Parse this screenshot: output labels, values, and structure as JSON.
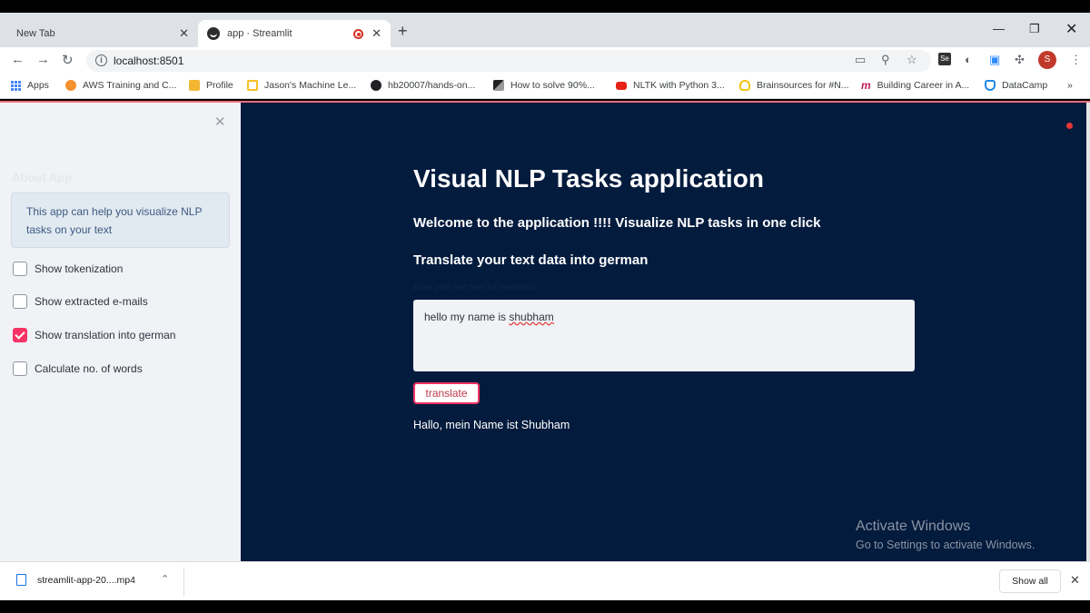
{
  "browser": {
    "tabs": [
      {
        "label": "New Tab"
      },
      {
        "label": "app · Streamlit"
      }
    ],
    "url": "localhost:8501",
    "profile_initial": "S",
    "bookmarks": [
      {
        "label": "Apps",
        "icon": "apps-grid-icon"
      },
      {
        "label": "AWS Training and C...",
        "icon": "aws-icon",
        "color": "#f5912e"
      },
      {
        "label": "Profile",
        "icon": "package-icon",
        "color": "#f2b633"
      },
      {
        "label": "Jason's Machine Le...",
        "icon": "bookmark-yellow-icon",
        "color": "#f6c026"
      },
      {
        "label": "hb20007/hands-on...",
        "icon": "github-icon",
        "color": "#202124"
      },
      {
        "label": "How to solve 90%...",
        "icon": "medium-icon",
        "color": "#555555"
      },
      {
        "label": "NLTK with Python 3...",
        "icon": "youtube-icon",
        "color": "#e62117"
      },
      {
        "label": "Brainsources for #N...",
        "icon": "bulb-icon",
        "color": "#f1c40f"
      },
      {
        "label": "Building Career in A...",
        "icon": "m-logo-icon",
        "color": "#c2185b"
      },
      {
        "label": "DataCamp",
        "icon": "datacamp-icon",
        "color": "#1e88e5"
      }
    ],
    "more_bookmarks": "»"
  },
  "sidebar": {
    "heading": "About App",
    "info": "This app can help you visualize NLP tasks on your text",
    "checkboxes": [
      {
        "label": "Show tokenization",
        "checked": false
      },
      {
        "label": "Show extracted e-mails",
        "checked": false
      },
      {
        "label": "Show translation into german",
        "checked": true
      },
      {
        "label": "Calculate no. of words",
        "checked": false
      }
    ]
  },
  "main": {
    "title": "Visual NLP Tasks application",
    "welcome": "Welcome to the application !!!! Visualize NLP tasks in one click",
    "subheader": "Translate your text data into german",
    "input_label": "Enter your text here for translation",
    "input_value_prefix": "hello my name is ",
    "input_value_misspelled": "shubham",
    "button_label": "translate",
    "result": "Hallo, mein Name ist Shubham",
    "accent_color": "#f63366"
  },
  "watermark": {
    "line1": "Activate Windows",
    "line2": "Go to Settings to activate Windows."
  },
  "downloads": {
    "file": "streamlit-app-20....mp4",
    "show_all": "Show all"
  }
}
